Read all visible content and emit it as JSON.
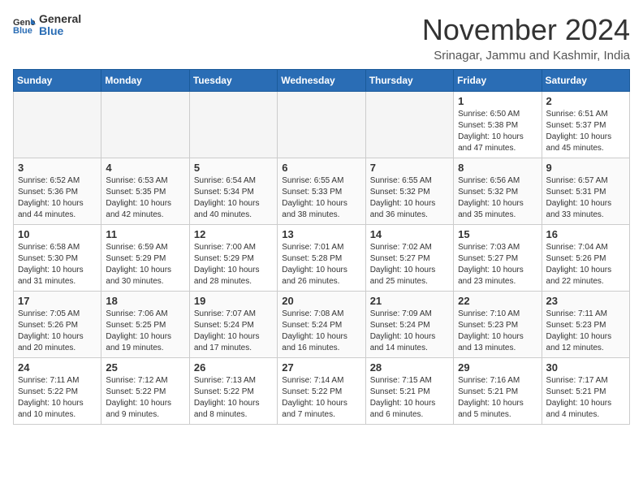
{
  "header": {
    "logo_general": "General",
    "logo_blue": "Blue",
    "month_title": "November 2024",
    "subtitle": "Srinagar, Jammu and Kashmir, India"
  },
  "days_of_week": [
    "Sunday",
    "Monday",
    "Tuesday",
    "Wednesday",
    "Thursday",
    "Friday",
    "Saturday"
  ],
  "weeks": [
    [
      {
        "day": "",
        "empty": true
      },
      {
        "day": "",
        "empty": true
      },
      {
        "day": "",
        "empty": true
      },
      {
        "day": "",
        "empty": true
      },
      {
        "day": "",
        "empty": true
      },
      {
        "day": "1",
        "sunrise": "6:50 AM",
        "sunset": "5:38 PM",
        "daylight": "10 hours and 47 minutes."
      },
      {
        "day": "2",
        "sunrise": "6:51 AM",
        "sunset": "5:37 PM",
        "daylight": "10 hours and 45 minutes."
      }
    ],
    [
      {
        "day": "3",
        "sunrise": "6:52 AM",
        "sunset": "5:36 PM",
        "daylight": "10 hours and 44 minutes."
      },
      {
        "day": "4",
        "sunrise": "6:53 AM",
        "sunset": "5:35 PM",
        "daylight": "10 hours and 42 minutes."
      },
      {
        "day": "5",
        "sunrise": "6:54 AM",
        "sunset": "5:34 PM",
        "daylight": "10 hours and 40 minutes."
      },
      {
        "day": "6",
        "sunrise": "6:55 AM",
        "sunset": "5:33 PM",
        "daylight": "10 hours and 38 minutes."
      },
      {
        "day": "7",
        "sunrise": "6:55 AM",
        "sunset": "5:32 PM",
        "daylight": "10 hours and 36 minutes."
      },
      {
        "day": "8",
        "sunrise": "6:56 AM",
        "sunset": "5:32 PM",
        "daylight": "10 hours and 35 minutes."
      },
      {
        "day": "9",
        "sunrise": "6:57 AM",
        "sunset": "5:31 PM",
        "daylight": "10 hours and 33 minutes."
      }
    ],
    [
      {
        "day": "10",
        "sunrise": "6:58 AM",
        "sunset": "5:30 PM",
        "daylight": "10 hours and 31 minutes."
      },
      {
        "day": "11",
        "sunrise": "6:59 AM",
        "sunset": "5:29 PM",
        "daylight": "10 hours and 30 minutes."
      },
      {
        "day": "12",
        "sunrise": "7:00 AM",
        "sunset": "5:29 PM",
        "daylight": "10 hours and 28 minutes."
      },
      {
        "day": "13",
        "sunrise": "7:01 AM",
        "sunset": "5:28 PM",
        "daylight": "10 hours and 26 minutes."
      },
      {
        "day": "14",
        "sunrise": "7:02 AM",
        "sunset": "5:27 PM",
        "daylight": "10 hours and 25 minutes."
      },
      {
        "day": "15",
        "sunrise": "7:03 AM",
        "sunset": "5:27 PM",
        "daylight": "10 hours and 23 minutes."
      },
      {
        "day": "16",
        "sunrise": "7:04 AM",
        "sunset": "5:26 PM",
        "daylight": "10 hours and 22 minutes."
      }
    ],
    [
      {
        "day": "17",
        "sunrise": "7:05 AM",
        "sunset": "5:26 PM",
        "daylight": "10 hours and 20 minutes."
      },
      {
        "day": "18",
        "sunrise": "7:06 AM",
        "sunset": "5:25 PM",
        "daylight": "10 hours and 19 minutes."
      },
      {
        "day": "19",
        "sunrise": "7:07 AM",
        "sunset": "5:24 PM",
        "daylight": "10 hours and 17 minutes."
      },
      {
        "day": "20",
        "sunrise": "7:08 AM",
        "sunset": "5:24 PM",
        "daylight": "10 hours and 16 minutes."
      },
      {
        "day": "21",
        "sunrise": "7:09 AM",
        "sunset": "5:24 PM",
        "daylight": "10 hours and 14 minutes."
      },
      {
        "day": "22",
        "sunrise": "7:10 AM",
        "sunset": "5:23 PM",
        "daylight": "10 hours and 13 minutes."
      },
      {
        "day": "23",
        "sunrise": "7:11 AM",
        "sunset": "5:23 PM",
        "daylight": "10 hours and 12 minutes."
      }
    ],
    [
      {
        "day": "24",
        "sunrise": "7:11 AM",
        "sunset": "5:22 PM",
        "daylight": "10 hours and 10 minutes."
      },
      {
        "day": "25",
        "sunrise": "7:12 AM",
        "sunset": "5:22 PM",
        "daylight": "10 hours and 9 minutes."
      },
      {
        "day": "26",
        "sunrise": "7:13 AM",
        "sunset": "5:22 PM",
        "daylight": "10 hours and 8 minutes."
      },
      {
        "day": "27",
        "sunrise": "7:14 AM",
        "sunset": "5:22 PM",
        "daylight": "10 hours and 7 minutes."
      },
      {
        "day": "28",
        "sunrise": "7:15 AM",
        "sunset": "5:21 PM",
        "daylight": "10 hours and 6 minutes."
      },
      {
        "day": "29",
        "sunrise": "7:16 AM",
        "sunset": "5:21 PM",
        "daylight": "10 hours and 5 minutes."
      },
      {
        "day": "30",
        "sunrise": "7:17 AM",
        "sunset": "5:21 PM",
        "daylight": "10 hours and 4 minutes."
      }
    ]
  ]
}
